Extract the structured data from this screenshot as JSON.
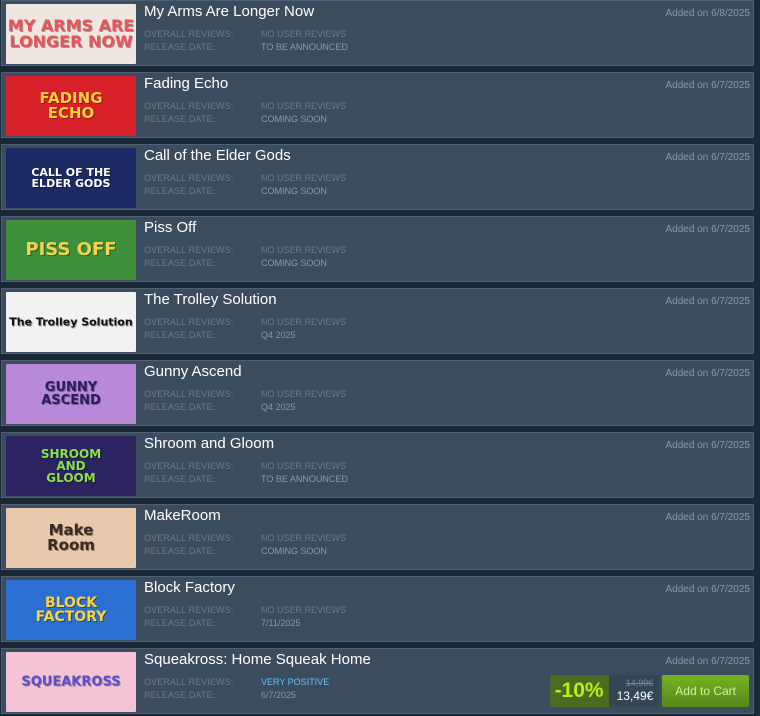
{
  "labels": {
    "reviews": "OVERALL REVIEWS:",
    "release": "RELEASE DATE:"
  },
  "items": [
    {
      "title": "My Arms Are Longer Now",
      "added": "Added on 6/8/2025",
      "reviews": "NO USER REVIEWS",
      "release": "TO BE ANNOUNCED",
      "capsule_text": "MY ARMS ARE\nLONGER NOW",
      "capsule_bg": "#efe6df",
      "capsule_fg": "#e8545a",
      "review_class": "none"
    },
    {
      "title": "Fading Echo",
      "added": "Added on 6/7/2025",
      "reviews": "NO USER REVIEWS",
      "release": "COMING SOON",
      "capsule_text": "FADING\nECHO",
      "capsule_bg": "#d8202b",
      "capsule_fg": "#f7d23a",
      "review_class": "none"
    },
    {
      "title": "Call of the Elder Gods",
      "added": "Added on 6/7/2025",
      "reviews": "NO USER REVIEWS",
      "release": "COMING SOON",
      "capsule_text": "CALL OF THE\nELDER GODS",
      "capsule_bg": "#1c2a63",
      "capsule_fg": "#ffffff",
      "review_class": "none"
    },
    {
      "title": "Piss Off",
      "added": "Added on 6/7/2025",
      "reviews": "NO USER REVIEWS",
      "release": "COMING SOON",
      "capsule_text": "PISS OFF",
      "capsule_bg": "#3e8f3a",
      "capsule_fg": "#f2d34a",
      "review_class": "none"
    },
    {
      "title": "The Trolley Solution",
      "added": "Added on 6/7/2025",
      "reviews": "NO USER REVIEWS",
      "release": "Q4 2025",
      "capsule_text": "The Trolley Solution",
      "capsule_bg": "#f2f2f2",
      "capsule_fg": "#111111",
      "review_class": "none"
    },
    {
      "title": "Gunny Ascend",
      "added": "Added on 6/7/2025",
      "reviews": "NO USER REVIEWS",
      "release": "Q4 2025",
      "capsule_text": "GUNNY\nASCEND",
      "capsule_bg": "#b889d8",
      "capsule_fg": "#2a1e5c",
      "review_class": "none"
    },
    {
      "title": "Shroom and Gloom",
      "added": "Added on 6/7/2025",
      "reviews": "NO USER REVIEWS",
      "release": "TO BE ANNOUNCED",
      "capsule_text": "SHROOM\nAND\nGLOOM",
      "capsule_bg": "#2b2460",
      "capsule_fg": "#8de04a",
      "review_class": "none"
    },
    {
      "title": "MakeRoom",
      "added": "Added on 6/7/2025",
      "reviews": "NO USER REVIEWS",
      "release": "COMING SOON",
      "capsule_text": "Make\nRoom",
      "capsule_bg": "#e9c9ad",
      "capsule_fg": "#3a2a22",
      "review_class": "none"
    },
    {
      "title": "Block Factory",
      "added": "Added on 6/7/2025",
      "reviews": "NO USER REVIEWS",
      "release": "7/11/2025",
      "capsule_text": "BLOCK\nFACTORY",
      "capsule_bg": "#2a6fd1",
      "capsule_fg": "#ffd23a",
      "review_class": "none"
    },
    {
      "title": "Squeakross: Home Squeak Home",
      "added": "Added on 6/7/2025",
      "reviews": "VERY POSITIVE",
      "release": "6/7/2025",
      "capsule_text": "SQUEAKROSS",
      "capsule_bg": "#f4c4d4",
      "capsule_fg": "#5a4fd0",
      "review_class": "pos"
    }
  ],
  "purchase": {
    "discount": "-10%",
    "original_price": "14,99€",
    "final_price": "13,49€",
    "cart_label": "Add to Cart"
  }
}
